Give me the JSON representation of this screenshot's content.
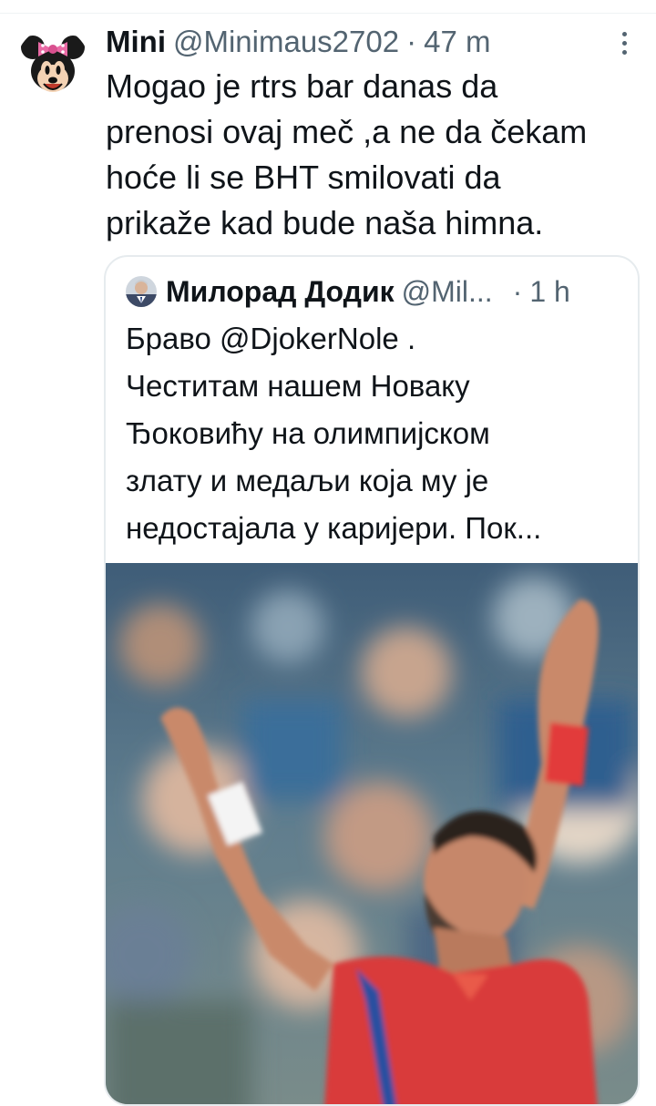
{
  "tweet": {
    "display_name": "Mini",
    "handle": "@Minimaus2702",
    "separator": "·",
    "time": "47 m",
    "text_lines": [
      "Mogao je rtrs bar danas da",
      "prenosi ovaj meč ,a ne da čekam",
      "hoće li se BHT smilovati da",
      "prikaže kad bude naša himna."
    ]
  },
  "quote": {
    "display_name": "Милорад Додик",
    "handle": "@Mil...",
    "separator": "·",
    "time": "1 h",
    "text_lines": [
      "Браво @DjokerNole .",
      "Честитам нашем Новаку",
      "Ђоковићу на олимпијском",
      "злату и медаљи која му је",
      "недостајала у каријери. Пок..."
    ]
  },
  "icons": {
    "avatar": "minnie-mouse-avatar",
    "quote_avatar": "profile-photo-avatar",
    "more": "more-options-icon",
    "photo": "tennis-player-celebrating-photo"
  },
  "colors": {
    "text_primary": "#0f1419",
    "text_secondary": "#536471",
    "border": "#e6ebee"
  }
}
